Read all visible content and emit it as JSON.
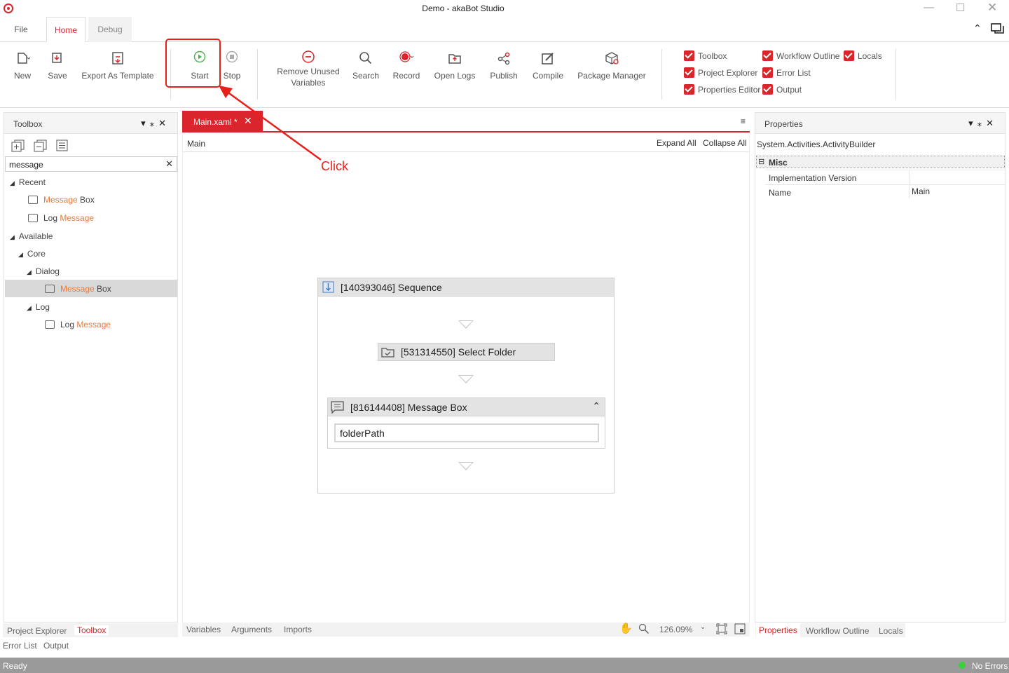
{
  "app": {
    "title": "Demo - akaBot Studio"
  },
  "menu": {
    "file": "File",
    "home": "Home",
    "debug": "Debug"
  },
  "ribbon": {
    "new": "New",
    "save": "Save",
    "export_template": "Export As Template",
    "start": "Start",
    "stop": "Stop",
    "remove_unused_1": "Remove Unused",
    "remove_unused_2": "Variables",
    "search": "Search",
    "record": "Record",
    "open_logs": "Open Logs",
    "publish": "Publish",
    "compile": "Compile",
    "package_manager": "Package Manager",
    "checks": {
      "toolbox": "Toolbox",
      "project_explorer": "Project Explorer",
      "properties_editor": "Properties Editor",
      "workflow_outline": "Workflow Outline",
      "error_list": "Error List",
      "output": "Output",
      "locals": "Locals"
    }
  },
  "annotation": {
    "text": "Click",
    "color": "#e8201b"
  },
  "toolbox": {
    "title": "Toolbox",
    "search_value": "message",
    "recent": "Recent",
    "available": "Available",
    "core": "Core",
    "dialog": "Dialog",
    "log": "Log",
    "hl": "Message",
    "box": "Box",
    "log_word": "Log"
  },
  "document": {
    "tab": "Main.xaml *",
    "breadcrumb": "Main",
    "expand_all": "Expand All",
    "collapse_all": "Collapse All"
  },
  "workflow": {
    "sequence": "[140393046] Sequence",
    "select_folder": "[531314550] Select Folder",
    "message_box": "[816144408] Message Box",
    "message_value": "folderPath"
  },
  "designer_footer": {
    "variables": "Variables",
    "arguments": "Arguments",
    "imports": "Imports",
    "zoom": "126.09%"
  },
  "properties": {
    "title": "Properties",
    "type": "System.Activities.ActivityBuilder",
    "category": "Misc",
    "rows": [
      {
        "name": "Implementation Version",
        "value": ""
      },
      {
        "name": "Name",
        "value": "Main"
      }
    ],
    "tabs": [
      "Properties",
      "Workflow Outline",
      "Locals"
    ]
  },
  "left_tabs": {
    "project_explorer": "Project Explorer",
    "toolbox": "Toolbox",
    "error_list": "Error List",
    "output": "Output"
  },
  "status": {
    "left": "Ready",
    "right": "No Errors"
  },
  "colors": {
    "accent": "#d9252b",
    "highlight": "#e87a3c",
    "status_ok": "#3ccf3c"
  }
}
